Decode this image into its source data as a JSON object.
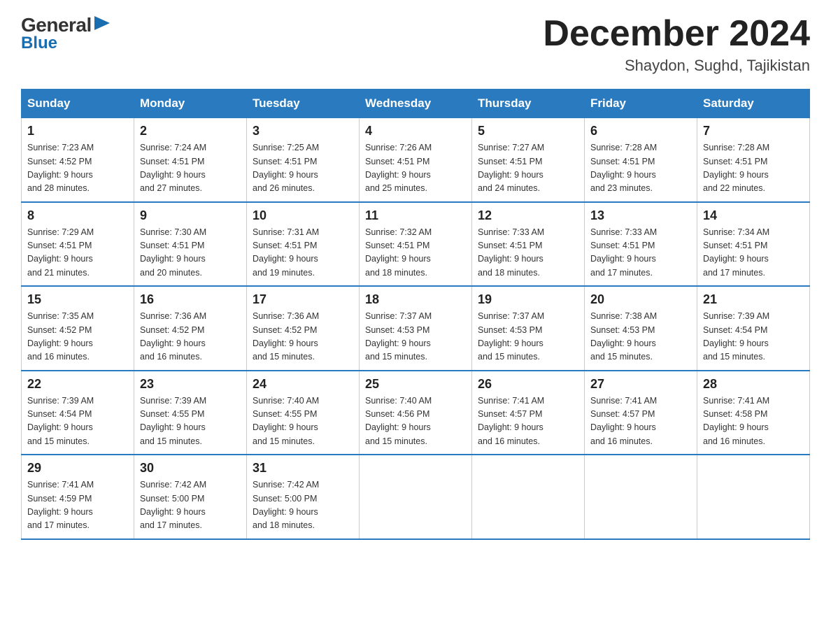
{
  "logo": {
    "general": "General",
    "blue": "Blue"
  },
  "title": "December 2024",
  "location": "Shaydon, Sughd, Tajikistan",
  "days_of_week": [
    "Sunday",
    "Monday",
    "Tuesday",
    "Wednesday",
    "Thursday",
    "Friday",
    "Saturday"
  ],
  "weeks": [
    [
      {
        "day": "1",
        "sunrise": "7:23 AM",
        "sunset": "4:52 PM",
        "daylight": "9 hours and 28 minutes."
      },
      {
        "day": "2",
        "sunrise": "7:24 AM",
        "sunset": "4:51 PM",
        "daylight": "9 hours and 27 minutes."
      },
      {
        "day": "3",
        "sunrise": "7:25 AM",
        "sunset": "4:51 PM",
        "daylight": "9 hours and 26 minutes."
      },
      {
        "day": "4",
        "sunrise": "7:26 AM",
        "sunset": "4:51 PM",
        "daylight": "9 hours and 25 minutes."
      },
      {
        "day": "5",
        "sunrise": "7:27 AM",
        "sunset": "4:51 PM",
        "daylight": "9 hours and 24 minutes."
      },
      {
        "day": "6",
        "sunrise": "7:28 AM",
        "sunset": "4:51 PM",
        "daylight": "9 hours and 23 minutes."
      },
      {
        "day": "7",
        "sunrise": "7:28 AM",
        "sunset": "4:51 PM",
        "daylight": "9 hours and 22 minutes."
      }
    ],
    [
      {
        "day": "8",
        "sunrise": "7:29 AM",
        "sunset": "4:51 PM",
        "daylight": "9 hours and 21 minutes."
      },
      {
        "day": "9",
        "sunrise": "7:30 AM",
        "sunset": "4:51 PM",
        "daylight": "9 hours and 20 minutes."
      },
      {
        "day": "10",
        "sunrise": "7:31 AM",
        "sunset": "4:51 PM",
        "daylight": "9 hours and 19 minutes."
      },
      {
        "day": "11",
        "sunrise": "7:32 AM",
        "sunset": "4:51 PM",
        "daylight": "9 hours and 18 minutes."
      },
      {
        "day": "12",
        "sunrise": "7:33 AM",
        "sunset": "4:51 PM",
        "daylight": "9 hours and 18 minutes."
      },
      {
        "day": "13",
        "sunrise": "7:33 AM",
        "sunset": "4:51 PM",
        "daylight": "9 hours and 17 minutes."
      },
      {
        "day": "14",
        "sunrise": "7:34 AM",
        "sunset": "4:51 PM",
        "daylight": "9 hours and 17 minutes."
      }
    ],
    [
      {
        "day": "15",
        "sunrise": "7:35 AM",
        "sunset": "4:52 PM",
        "daylight": "9 hours and 16 minutes."
      },
      {
        "day": "16",
        "sunrise": "7:36 AM",
        "sunset": "4:52 PM",
        "daylight": "9 hours and 16 minutes."
      },
      {
        "day": "17",
        "sunrise": "7:36 AM",
        "sunset": "4:52 PM",
        "daylight": "9 hours and 15 minutes."
      },
      {
        "day": "18",
        "sunrise": "7:37 AM",
        "sunset": "4:53 PM",
        "daylight": "9 hours and 15 minutes."
      },
      {
        "day": "19",
        "sunrise": "7:37 AM",
        "sunset": "4:53 PM",
        "daylight": "9 hours and 15 minutes."
      },
      {
        "day": "20",
        "sunrise": "7:38 AM",
        "sunset": "4:53 PM",
        "daylight": "9 hours and 15 minutes."
      },
      {
        "day": "21",
        "sunrise": "7:39 AM",
        "sunset": "4:54 PM",
        "daylight": "9 hours and 15 minutes."
      }
    ],
    [
      {
        "day": "22",
        "sunrise": "7:39 AM",
        "sunset": "4:54 PM",
        "daylight": "9 hours and 15 minutes."
      },
      {
        "day": "23",
        "sunrise": "7:39 AM",
        "sunset": "4:55 PM",
        "daylight": "9 hours and 15 minutes."
      },
      {
        "day": "24",
        "sunrise": "7:40 AM",
        "sunset": "4:55 PM",
        "daylight": "9 hours and 15 minutes."
      },
      {
        "day": "25",
        "sunrise": "7:40 AM",
        "sunset": "4:56 PM",
        "daylight": "9 hours and 15 minutes."
      },
      {
        "day": "26",
        "sunrise": "7:41 AM",
        "sunset": "4:57 PM",
        "daylight": "9 hours and 16 minutes."
      },
      {
        "day": "27",
        "sunrise": "7:41 AM",
        "sunset": "4:57 PM",
        "daylight": "9 hours and 16 minutes."
      },
      {
        "day": "28",
        "sunrise": "7:41 AM",
        "sunset": "4:58 PM",
        "daylight": "9 hours and 16 minutes."
      }
    ],
    [
      {
        "day": "29",
        "sunrise": "7:41 AM",
        "sunset": "4:59 PM",
        "daylight": "9 hours and 17 minutes."
      },
      {
        "day": "30",
        "sunrise": "7:42 AM",
        "sunset": "5:00 PM",
        "daylight": "9 hours and 17 minutes."
      },
      {
        "day": "31",
        "sunrise": "7:42 AM",
        "sunset": "5:00 PM",
        "daylight": "9 hours and 18 minutes."
      },
      null,
      null,
      null,
      null
    ]
  ],
  "labels": {
    "sunrise": "Sunrise:",
    "sunset": "Sunset:",
    "daylight": "Daylight:"
  }
}
